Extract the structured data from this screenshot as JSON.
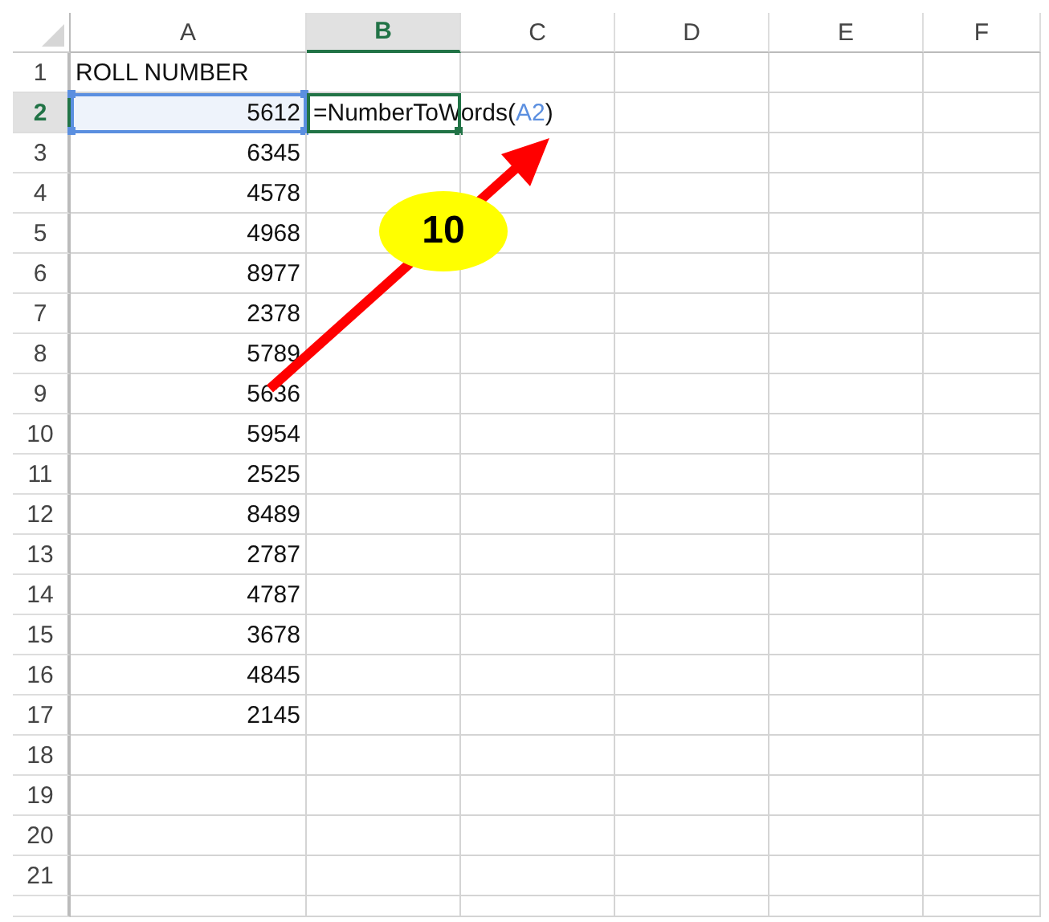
{
  "columns": [
    {
      "label": "A",
      "selected": false
    },
    {
      "label": "B",
      "selected": true
    },
    {
      "label": "C",
      "selected": false
    },
    {
      "label": "D",
      "selected": false
    },
    {
      "label": "E",
      "selected": false
    },
    {
      "label": "F",
      "selected": false
    }
  ],
  "rows": [
    {
      "label": "1",
      "selected": false,
      "a": {
        "kind": "text",
        "value": "ROLL NUMBER",
        "referenced": false
      }
    },
    {
      "label": "2",
      "selected": true,
      "a": {
        "kind": "number",
        "value": "5612",
        "referenced": true
      },
      "b": {
        "kind": "formula",
        "active": true,
        "prefix": "=NumberToWords(",
        "ref": "A2",
        "suffix": ")"
      }
    },
    {
      "label": "3",
      "selected": false,
      "a": {
        "kind": "number",
        "value": "6345",
        "referenced": false
      }
    },
    {
      "label": "4",
      "selected": false,
      "a": {
        "kind": "number",
        "value": "4578",
        "referenced": false
      }
    },
    {
      "label": "5",
      "selected": false,
      "a": {
        "kind": "number",
        "value": "4968",
        "referenced": false
      }
    },
    {
      "label": "6",
      "selected": false,
      "a": {
        "kind": "number",
        "value": "8977",
        "referenced": false
      }
    },
    {
      "label": "7",
      "selected": false,
      "a": {
        "kind": "number",
        "value": "2378",
        "referenced": false
      }
    },
    {
      "label": "8",
      "selected": false,
      "a": {
        "kind": "number",
        "value": "5789",
        "referenced": false
      }
    },
    {
      "label": "9",
      "selected": false,
      "a": {
        "kind": "number",
        "value": "5636",
        "referenced": false
      }
    },
    {
      "label": "10",
      "selected": false,
      "a": {
        "kind": "number",
        "value": "5954",
        "referenced": false
      }
    },
    {
      "label": "11",
      "selected": false,
      "a": {
        "kind": "number",
        "value": "2525",
        "referenced": false
      }
    },
    {
      "label": "12",
      "selected": false,
      "a": {
        "kind": "number",
        "value": "8489",
        "referenced": false
      }
    },
    {
      "label": "13",
      "selected": false,
      "a": {
        "kind": "number",
        "value": "2787",
        "referenced": false
      }
    },
    {
      "label": "14",
      "selected": false,
      "a": {
        "kind": "number",
        "value": "4787",
        "referenced": false
      }
    },
    {
      "label": "15",
      "selected": false,
      "a": {
        "kind": "number",
        "value": "3678",
        "referenced": false
      }
    },
    {
      "label": "16",
      "selected": false,
      "a": {
        "kind": "number",
        "value": "4845",
        "referenced": false
      }
    },
    {
      "label": "17",
      "selected": false,
      "a": {
        "kind": "number",
        "value": "2145",
        "referenced": false
      }
    },
    {
      "label": "18",
      "selected": false
    },
    {
      "label": "19",
      "selected": false
    },
    {
      "label": "20",
      "selected": false
    },
    {
      "label": "21",
      "selected": false
    }
  ],
  "callout": {
    "label": "10"
  }
}
